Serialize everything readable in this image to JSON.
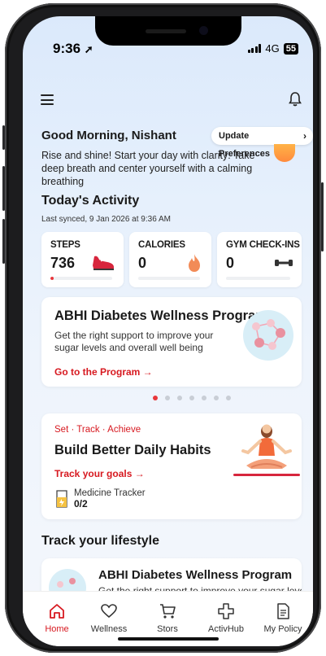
{
  "status": {
    "time": "9:36",
    "network": "4G",
    "battery": "55"
  },
  "header": {
    "greeting": "Good Morning, Nishant",
    "update_button": "Update Preferences",
    "description": "Rise and shine! Start your day with clarity: Take deep breath and center yourself with a calming breathing"
  },
  "activity": {
    "title": "Today's Activity",
    "synced": "Last synced, 9 Jan 2026 at 9:36 AM",
    "cards": [
      {
        "label": "STEPS",
        "value": "736",
        "progress": 0.05,
        "icon": "sneaker-icon"
      },
      {
        "label": "CALORIES",
        "value": "0",
        "progress": 0,
        "icon": "flame-icon"
      },
      {
        "label": "GYM CHECK-INS",
        "value": "0",
        "progress": 0,
        "icon": "dumbbell-icon"
      }
    ]
  },
  "program_card": {
    "title": "ABHI Diabetes Wellness Program",
    "subtitle": "Get the right support to improve your sugar levels and overall well being",
    "link": "Go to the Program →"
  },
  "carousel": {
    "active_index": 0,
    "count": 7
  },
  "habits_card": {
    "tagline": "Set · Track · Achieve",
    "title": "Build Better Daily Habits",
    "link": "Track your goals →",
    "tracker_label": "Medicine Tracker",
    "tracker_value": "0/2"
  },
  "lifestyle": {
    "title": "Track your lifestyle",
    "card_title": "ABHI Diabetes Wellness Program",
    "card_subtitle": "Get the right support to improve your sugar levels"
  },
  "nav": [
    {
      "label": "Home",
      "icon": "home-icon",
      "active": true
    },
    {
      "label": "Wellness",
      "icon": "heart-icon",
      "active": false
    },
    {
      "label": "Stors",
      "icon": "cart-icon",
      "active": false
    },
    {
      "label": "ActivHub",
      "icon": "plus-icon",
      "active": false
    },
    {
      "label": "My Policy",
      "icon": "document-icon",
      "active": false
    }
  ],
  "colors": {
    "accent": "#d71920",
    "background": "#dbe9fb"
  }
}
